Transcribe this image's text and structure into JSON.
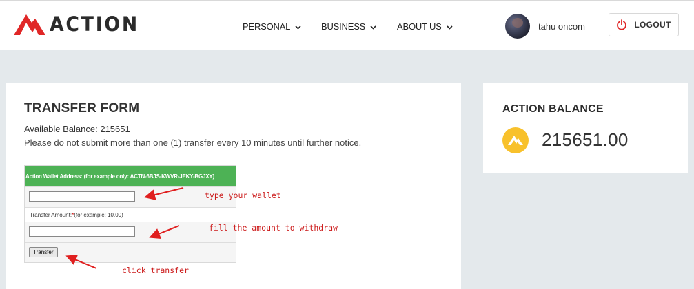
{
  "brand": {
    "name": "ACTION",
    "accent": "#e02727"
  },
  "nav": {
    "items": [
      {
        "label": "PERSONAL"
      },
      {
        "label": "BUSINESS"
      },
      {
        "label": "ABOUT US"
      }
    ]
  },
  "user": {
    "name": "tahu oncom"
  },
  "logout": {
    "label": "LOGOUT"
  },
  "transfer_form": {
    "title": "TRANSFER FORM",
    "available_balance_label": "Available Balance: 215651",
    "notice": "Please do not submit more than one (1) transfer every 10 minutes until further notice.",
    "wallet_header": "Action Wallet Address: (for example only: ACTN-6BJS-KWVR-JEKY-BGJXY)",
    "wallet_value": "",
    "amount_label": "Transfer Amount: ",
    "amount_required_mark": "*",
    "amount_example": "(for example: 10.00)",
    "amount_value": "",
    "button_label": "Transfer"
  },
  "annotations": {
    "wallet_hint": "type your wallet",
    "amount_hint": "fill the amount to withdraw",
    "button_hint": "click transfer"
  },
  "balance_card": {
    "title": "ACTION BALANCE",
    "value": "215651.00",
    "coin_color": "#f8c12c"
  },
  "colors": {
    "page_bg": "#e4e9ec",
    "form_header_green": "#4db255",
    "annotation_red": "#cc1b1b"
  }
}
